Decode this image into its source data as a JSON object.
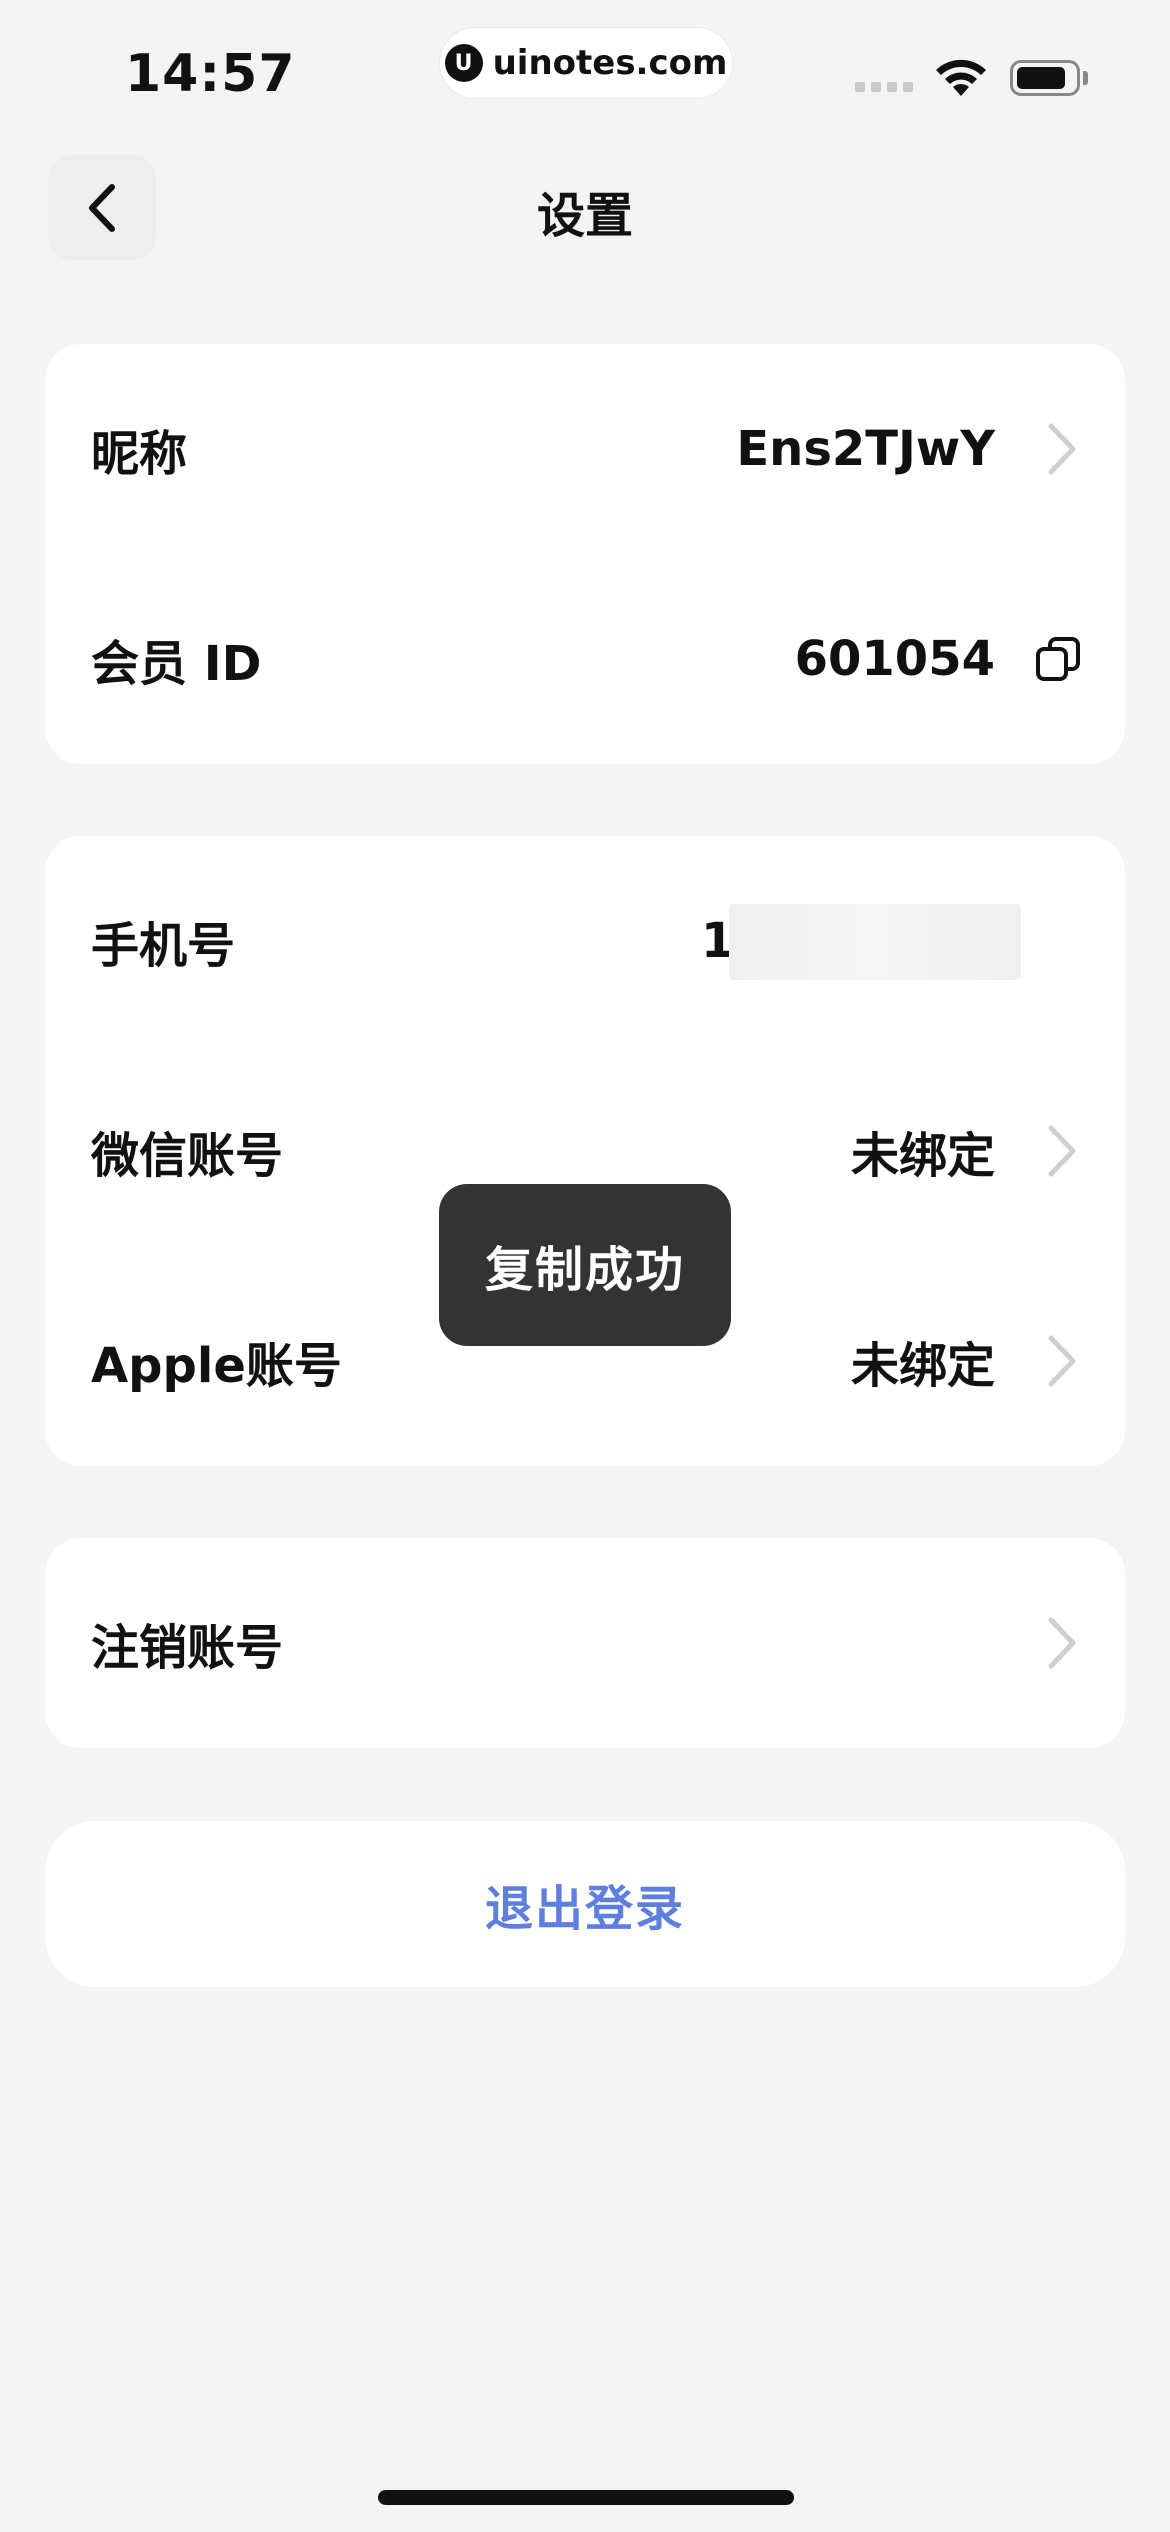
{
  "status_bar": {
    "time": "14:57",
    "site": "uinotes.com",
    "site_logo_letter": "U"
  },
  "nav": {
    "title": "设置",
    "back_icon": "chevron-left-icon"
  },
  "profile_card": {
    "nickname_label": "昵称",
    "nickname_value": "Ens2TJwY",
    "member_id_label": "会员 ID",
    "member_id_value": "601054"
  },
  "account_card": {
    "phone_label": "手机号",
    "phone_value_visible": "1",
    "wechat_label": "微信账号",
    "wechat_value": "未绑定",
    "apple_label": "Apple账号",
    "apple_value": "未绑定"
  },
  "delete_card": {
    "label": "注销账号"
  },
  "toast": {
    "text": "复制成功"
  },
  "logout": {
    "label": "退出登录",
    "color": "#5f7fe0"
  },
  "colors": {
    "background": "#f4f4f4",
    "card": "#ffffff",
    "toast_bg": "#333333",
    "chevron": "#cfcfcf"
  }
}
